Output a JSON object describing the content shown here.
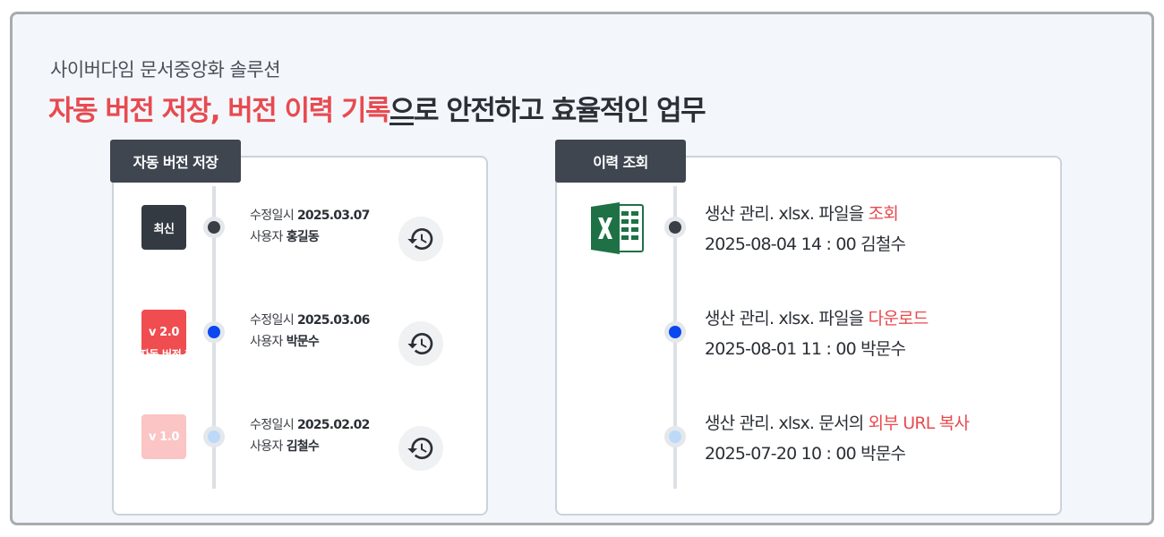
{
  "subtitle": "사이버다임 문서중앙화 솔루션",
  "headline": {
    "red_part": "자동 버전 저장, 버전 이력  기록",
    "underlined_part": "으",
    "rest": "로  안전하고 효율적인 업무"
  },
  "colors": {
    "accent_red": "#e84a4f",
    "tab_bg": "#3f4650",
    "frame_bg": "#f3f7fc"
  },
  "left_panel": {
    "tab_label": "자동 버전 저장",
    "versions": [
      {
        "badge": "최신",
        "badge_ghost": "",
        "badge_color": "#333a42",
        "dot_color": "#3a3f46",
        "date_label": "수정일시",
        "date": "2025.03.07",
        "user_label": "사용자",
        "user": "홍길동",
        "icon": "restore-history-icon"
      },
      {
        "badge": "v 2.0",
        "badge_ghost": "자동 버전 저",
        "badge_color": "#ef4d50",
        "dot_color": "#0b47f0",
        "date_label": "수정일시",
        "date": "2025.03.06",
        "user_label": "사용자",
        "user": "박문수",
        "icon": "restore-history-icon"
      },
      {
        "badge": "v 1.0",
        "badge_ghost": "",
        "badge_color": "#fbc4c5",
        "dot_color": "#bcdaf8",
        "date_label": "수정일시",
        "date": "2025.02.02",
        "user_label": "사용자",
        "user": "김철수",
        "icon": "restore-history-icon"
      }
    ]
  },
  "right_panel": {
    "tab_label": "이력 조회",
    "file_icon": "excel-file-icon",
    "events": [
      {
        "prefix": "생산 관리. xlsx. 파일을 ",
        "action": "조회",
        "time": "2025-08-04 14 : 00",
        "user": "김철수",
        "dot_color": "#3a3f46"
      },
      {
        "prefix": "생산 관리. xlsx. 파일을 ",
        "action": "다운로드",
        "time": "2025-08-01 11 : 00",
        "user": "박문수",
        "dot_color": "#0b47f0"
      },
      {
        "prefix": "생산 관리. xlsx. 문서의 ",
        "action": "외부 URL 복사",
        "time": "2025-07-20 10 : 00",
        "user": "박문수",
        "dot_color": "#bcdaf8"
      }
    ]
  }
}
